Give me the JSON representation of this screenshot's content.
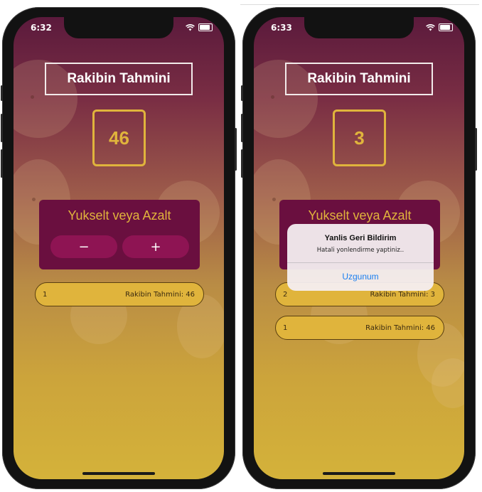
{
  "left_screen": {
    "status_time": "6:32",
    "title": "Rakibin Tahmini",
    "guess_value": "46",
    "panel_label": "Yukselt veya Azalt",
    "minus_label": "−",
    "plus_label": "+",
    "log": [
      {
        "index": "1",
        "text": "Rakibin Tahmini: 46"
      }
    ]
  },
  "right_screen": {
    "status_time": "6:33",
    "title": "Rakibin Tahmini",
    "guess_value": "3",
    "panel_label": "Yukselt veya Azalt",
    "log": [
      {
        "index": "2",
        "text": "Rakibin Tahmini: 3"
      },
      {
        "index": "1",
        "text": "Rakibin Tahmini: 46"
      }
    ],
    "alert": {
      "title": "Yanlis Geri Bildirim",
      "message": "Hatali yonlendirme yaptiniz..",
      "action_label": "Uzgunum"
    }
  },
  "colors": {
    "accent_gold": "#e0b43c",
    "panel_maroon": "#6a0f3f",
    "button_magenta": "#8e1453",
    "alert_action_blue": "#1a7ff0"
  },
  "icons": [
    "wifi-icon",
    "battery-icon",
    "signal-icon"
  ]
}
